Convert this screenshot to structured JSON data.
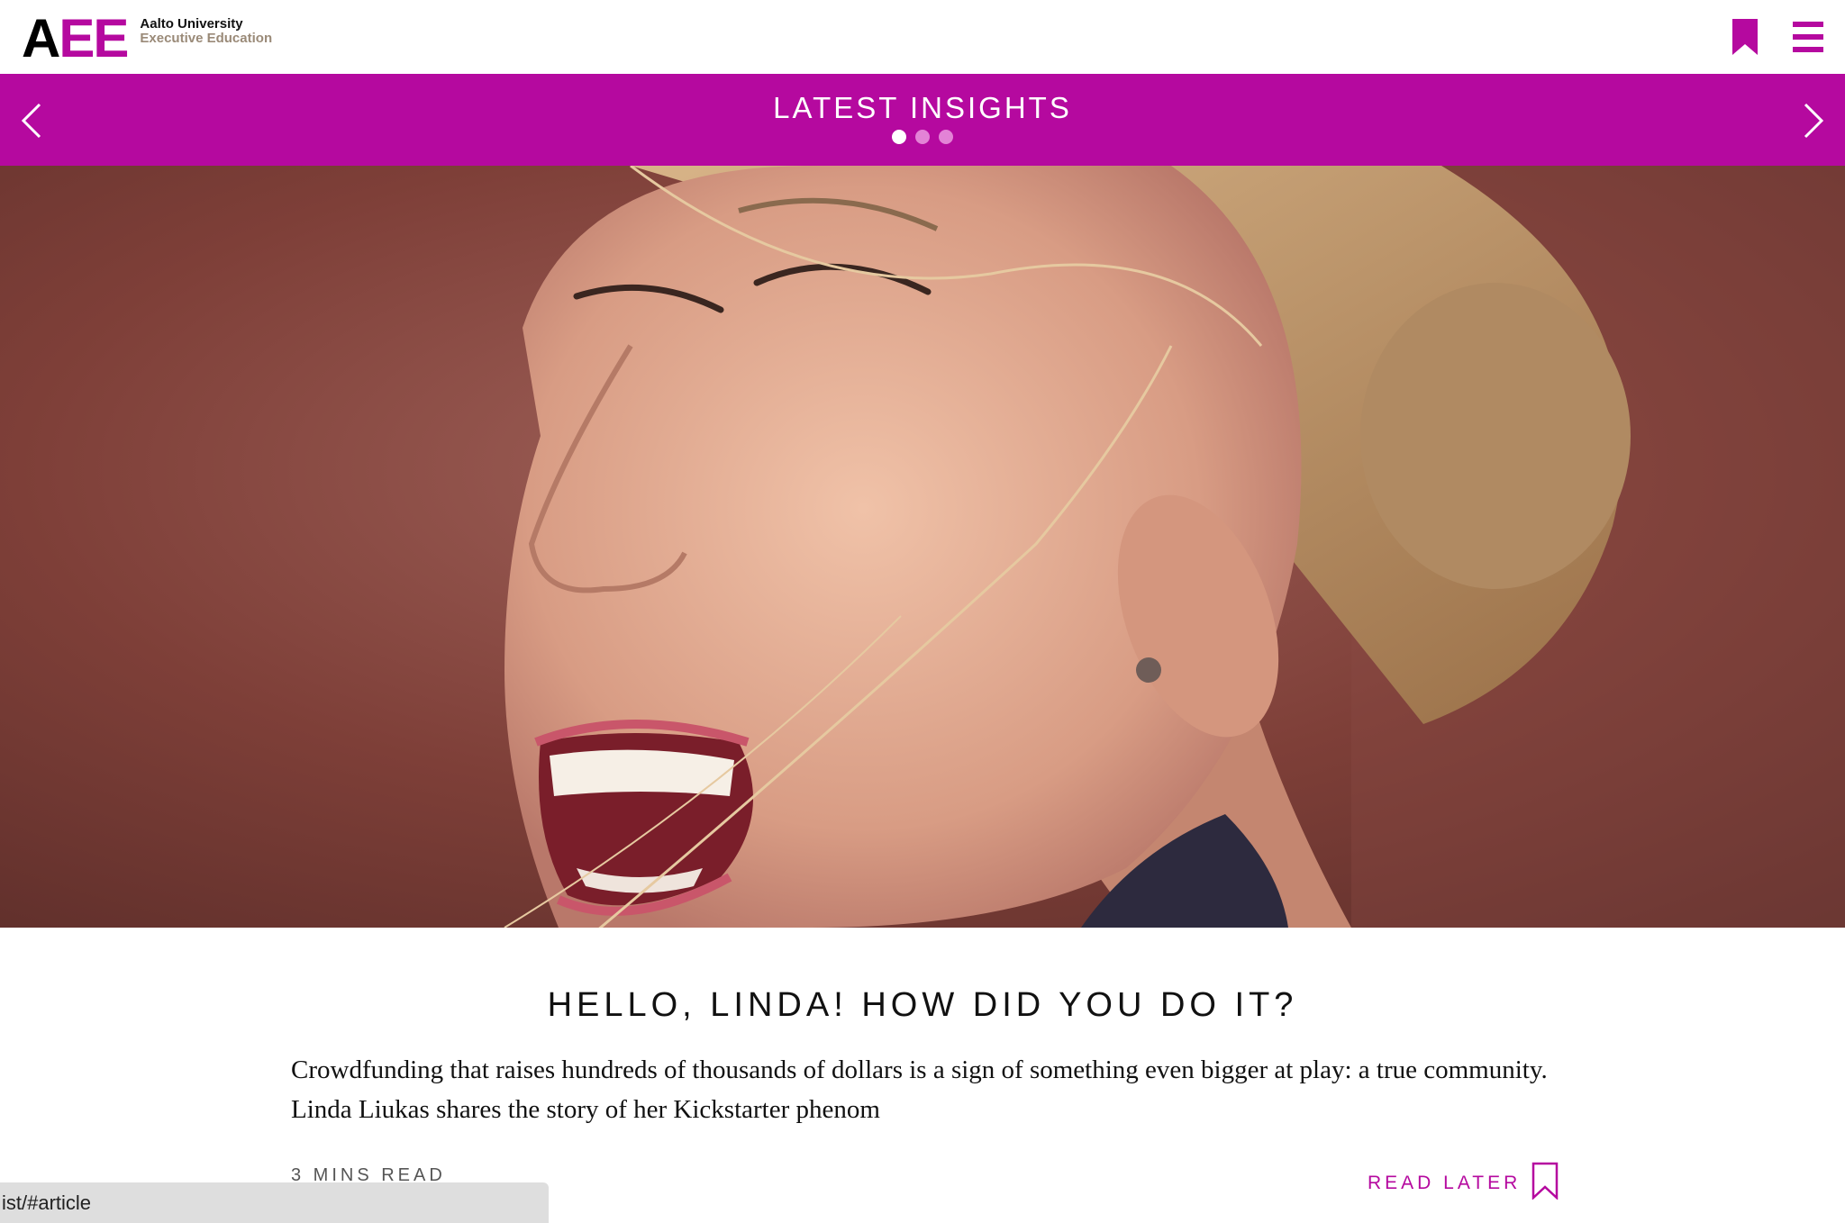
{
  "header": {
    "logo": {
      "mark_a": "A",
      "mark_ee": "EE",
      "line1": "Aalto University",
      "line2": "Executive Education"
    },
    "icons": [
      "bookmark-icon",
      "hamburger-menu-icon"
    ]
  },
  "insights_bar": {
    "title": "LATEST INSIGHTS",
    "dots_count": 3,
    "active_dot": 1,
    "icons": [
      "chevron-left-icon",
      "chevron-right-icon"
    ]
  },
  "hero": {
    "subject": "photo"
  },
  "article": {
    "title": "HELLO, LINDA! HOW DID YOU DO IT?",
    "excerpt": "Crowdfunding that raises hundreds of thousands of dollars is a sign of something even bigger at play: a true community. Linda Liukas shares the story of her Kickstarter phenom",
    "read_time": "3 MINS READ",
    "read_later": "READ LATER"
  },
  "status_bar": {
    "url": "ist/#article"
  },
  "colors": {
    "accent": "#b5099f",
    "dot_inactive": "#e383d6",
    "status_bg": "#dedede"
  }
}
